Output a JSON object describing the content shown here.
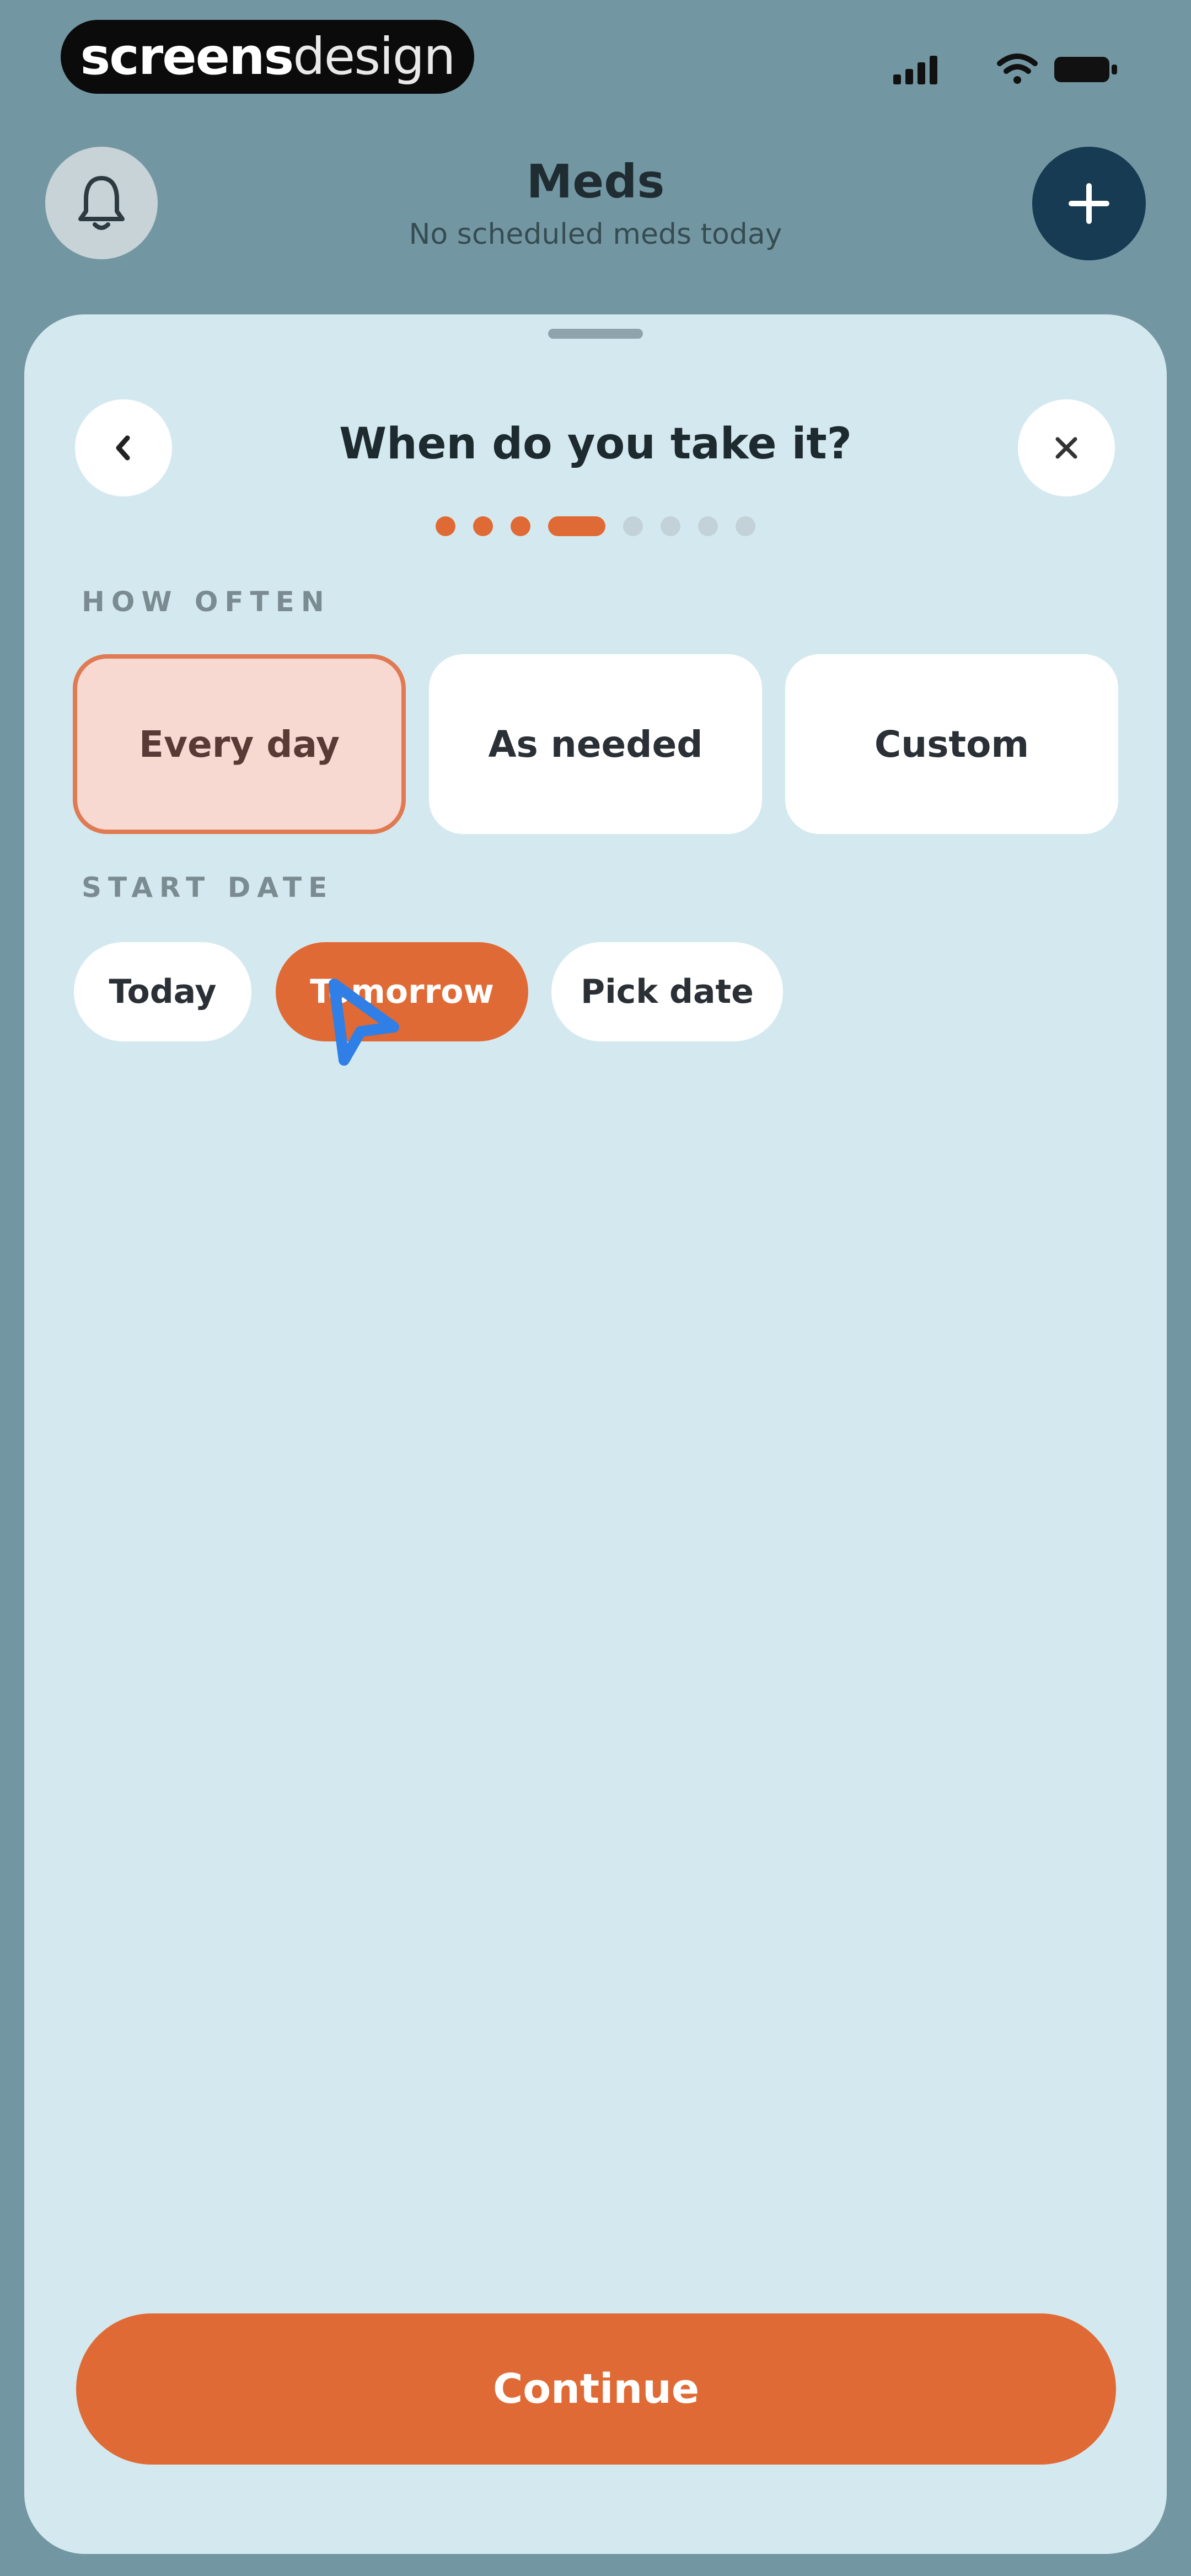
{
  "status_bar": {
    "brand_bold": "screens",
    "brand_light": "design"
  },
  "header": {
    "title": "Meds",
    "subtitle": "No scheduled meds today"
  },
  "sheet": {
    "title": "When do you take it?",
    "progress": {
      "total_steps": 8,
      "current_step": 4
    },
    "how_often": {
      "label": "HOW OFTEN",
      "options": [
        "Every day",
        "As needed",
        "Custom"
      ],
      "selected": "Every day"
    },
    "start_date": {
      "label": "START DATE",
      "options": [
        "Today",
        "Tomorrow",
        "Pick date"
      ],
      "selected": "Tomorrow"
    },
    "continue_label": "Continue"
  },
  "colors": {
    "accent": "#e06a35",
    "sheet_background": "#d4e9ef",
    "add_button": "#163b52"
  },
  "icons": {
    "notifications": "bell-icon",
    "add": "plus-icon",
    "back": "chevron-left-icon",
    "close": "close-icon",
    "cursor": "pointer-cursor-icon"
  }
}
